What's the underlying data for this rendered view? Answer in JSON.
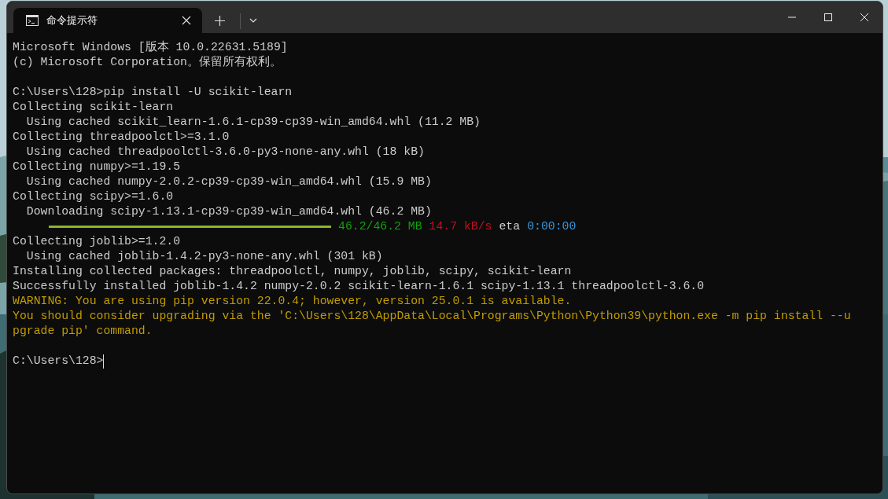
{
  "tabs": [
    {
      "title": "命令提示符",
      "selected": true
    }
  ],
  "lines": [
    {
      "kind": "normal",
      "text": "Microsoft Windows [版本 10.0.22631.5189]"
    },
    {
      "kind": "normal",
      "text": "(c) Microsoft Corporation。保留所有权利。"
    },
    {
      "kind": "blank"
    },
    {
      "kind": "normal",
      "text": "C:\\Users\\128>pip install -U scikit-learn"
    },
    {
      "kind": "normal",
      "text": "Collecting scikit-learn"
    },
    {
      "kind": "normal",
      "text": "  Using cached scikit_learn-1.6.1-cp39-cp39-win_amd64.whl (11.2 MB)"
    },
    {
      "kind": "normal",
      "text": "Collecting threadpoolctl>=3.1.0"
    },
    {
      "kind": "normal",
      "text": "  Using cached threadpoolctl-3.6.0-py3-none-any.whl (18 kB)"
    },
    {
      "kind": "normal",
      "text": "Collecting numpy>=1.19.5"
    },
    {
      "kind": "normal",
      "text": "  Using cached numpy-2.0.2-cp39-cp39-win_amd64.whl (15.9 MB)"
    },
    {
      "kind": "normal",
      "text": "Collecting scipy>=1.6.0"
    },
    {
      "kind": "normal",
      "text": "  Downloading scipy-1.13.1-cp39-cp39-win_amd64.whl (46.2 MB)"
    },
    {
      "kind": "progress",
      "level": 1,
      "size": "46.2/46.2 MB",
      "speed": "14.7 kB/s",
      "eta_label": "eta",
      "eta": "0:00:00"
    },
    {
      "kind": "normal",
      "text": "Collecting joblib>=1.2.0"
    },
    {
      "kind": "normal",
      "text": "  Using cached joblib-1.4.2-py3-none-any.whl (301 kB)"
    },
    {
      "kind": "normal",
      "text": "Installing collected packages: threadpoolctl, numpy, joblib, scipy, scikit-learn"
    },
    {
      "kind": "normal",
      "text": "Successfully installed joblib-1.4.2 numpy-2.0.2 scikit-learn-1.6.1 scipy-1.13.1 threadpoolctl-3.6.0"
    },
    {
      "kind": "warning",
      "text": "WARNING: You are using pip version 22.0.4; however, version 25.0.1 is available."
    },
    {
      "kind": "warning",
      "text": "You should consider upgrading via the 'C:\\Users\\128\\AppData\\Local\\Programs\\Python\\Python39\\python.exe -m pip install --u"
    },
    {
      "kind": "warning",
      "text": "pgrade pip' command."
    },
    {
      "kind": "blank"
    },
    {
      "kind": "prompt",
      "text": "C:\\Users\\128>"
    }
  ]
}
